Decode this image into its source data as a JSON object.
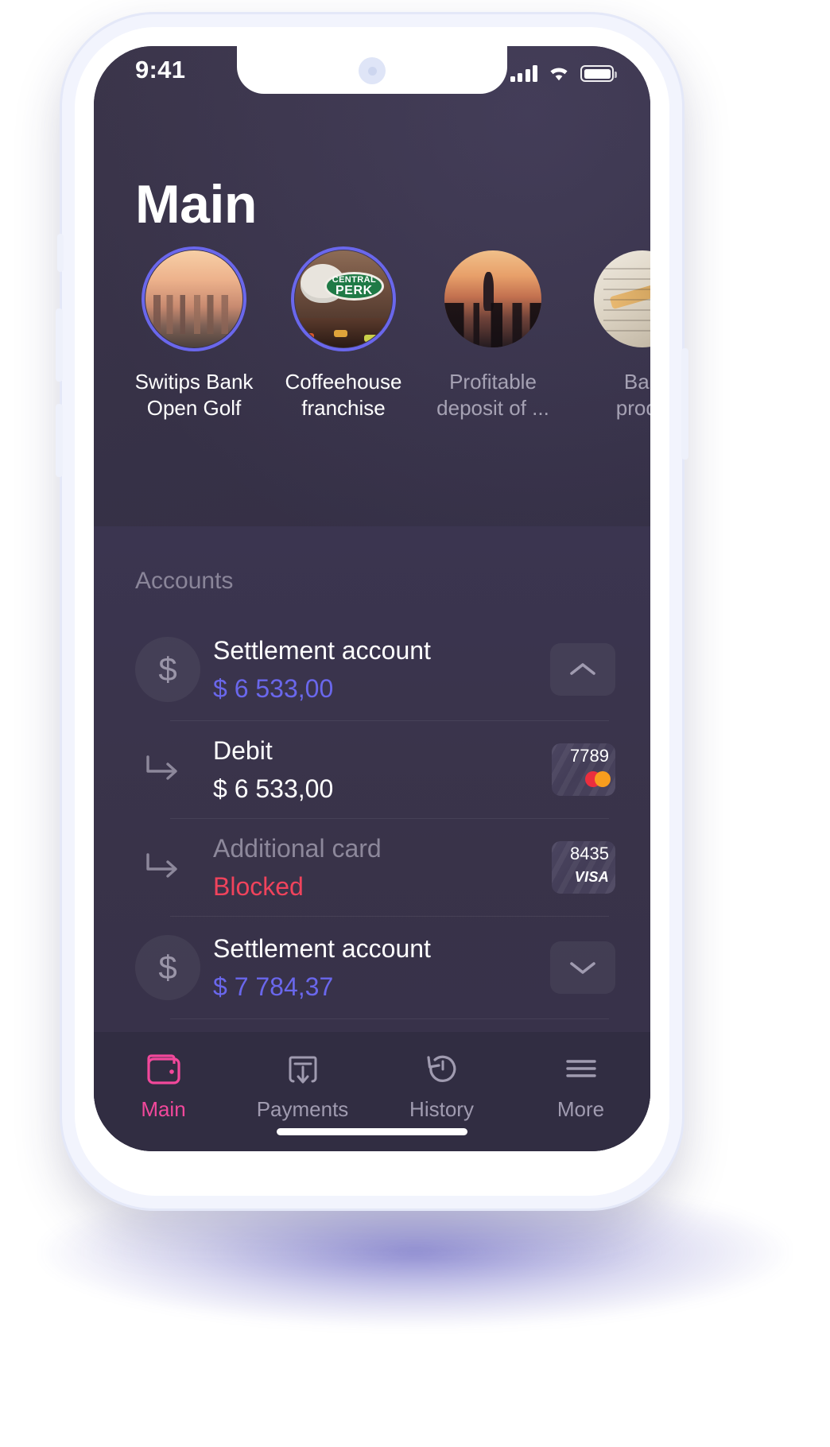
{
  "statusbar": {
    "time": "9:41",
    "signal_icon": "cellular-signal-icon",
    "wifi_icon": "wifi-icon",
    "battery_icon": "battery-full-icon"
  },
  "header": {
    "title": "Main"
  },
  "stories": [
    {
      "label": "Switips Bank\nOpen Golf",
      "active": true,
      "dim": false,
      "art": "city-skyline"
    },
    {
      "label": "Coffeehouse\nfranchise",
      "active": true,
      "dim": false,
      "art": "central-perk"
    },
    {
      "label": "Profitable\ndeposit of ...",
      "active": false,
      "dim": true,
      "art": "sunset-climber"
    },
    {
      "label": "Ban\nprodu",
      "active": false,
      "dim": true,
      "art": "paper-pencil"
    }
  ],
  "accounts": {
    "section_title": "Accounts",
    "rows": [
      {
        "kind": "account",
        "icon": "dollar-circle-icon",
        "name": "Settlement account",
        "amount": "$ 6 533,00",
        "amount_style": "accent",
        "trail": "chevron-up",
        "dim": false
      },
      {
        "kind": "card",
        "icon": "arrow-branch-icon",
        "name": "Debit",
        "amount": "$ 6 533,00",
        "amount_style": "white",
        "trail": "card",
        "card_number": "7789",
        "card_brand": "mastercard",
        "dim": false
      },
      {
        "kind": "card",
        "icon": "arrow-branch-icon",
        "name": "Additional card",
        "amount": "Blocked",
        "amount_style": "danger",
        "trail": "card",
        "card_number": "8435",
        "card_brand": "visa",
        "dim": true
      },
      {
        "kind": "account",
        "icon": "dollar-circle-icon",
        "name": "Settlement account",
        "amount": "$ 7 784,37",
        "amount_style": "accent",
        "trail": "chevron-down",
        "dim": false
      }
    ]
  },
  "tabbar": {
    "items": [
      {
        "label": "Main",
        "icon": "wallet-icon",
        "active": true
      },
      {
        "label": "Payments",
        "icon": "download-box-icon",
        "active": false
      },
      {
        "label": "History",
        "icon": "clock-rewind-icon",
        "active": false
      },
      {
        "label": "More",
        "icon": "hamburger-menu-icon",
        "active": false
      }
    ]
  },
  "colors": {
    "accent_purple": "#6a67ec",
    "accent_pink": "#f2489b",
    "danger_red": "#f0435c",
    "screen_bg": "#363147",
    "panel_bg": "#3b3550",
    "muted_text": "#8a8599"
  },
  "card_brands": {
    "visa_text": "VISA"
  }
}
